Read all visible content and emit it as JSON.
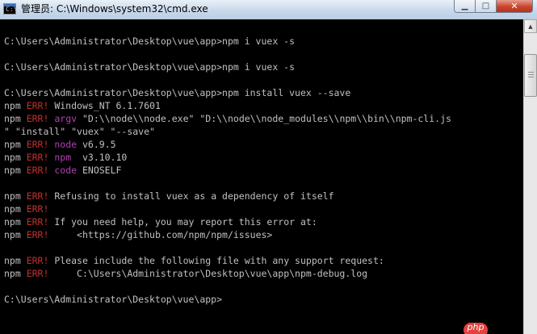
{
  "window": {
    "title": "管理员: C:\\Windows\\system32\\cmd.exe",
    "icon": "cmd-console-icon",
    "icon_glyph": "C:\\",
    "minimize_label": "▁",
    "maximize_label": "□",
    "close_label": "✕"
  },
  "console": {
    "lines": [
      {
        "parts": [
          {
            "t": "C:\\Users\\Administrator\\Desktop\\vue\\app>npm i vuex -s",
            "c": "normal"
          }
        ]
      },
      {
        "parts": [
          {
            "t": "",
            "c": "normal"
          }
        ]
      },
      {
        "parts": [
          {
            "t": "C:\\Users\\Administrator\\Desktop\\vue\\app>npm i vuex -s",
            "c": "normal"
          }
        ]
      },
      {
        "parts": [
          {
            "t": "",
            "c": "normal"
          }
        ]
      },
      {
        "parts": [
          {
            "t": "C:\\Users\\Administrator\\Desktop\\vue\\app>npm install vuex --save",
            "c": "normal"
          }
        ]
      },
      {
        "parts": [
          {
            "t": "npm ",
            "c": "normal"
          },
          {
            "t": "ERR!",
            "c": "err"
          },
          {
            "t": " Windows_NT 6.1.7601",
            "c": "normal"
          }
        ]
      },
      {
        "parts": [
          {
            "t": "npm ",
            "c": "normal"
          },
          {
            "t": "ERR!",
            "c": "err"
          },
          {
            "t": " ",
            "c": "normal"
          },
          {
            "t": "argv",
            "c": "mag"
          },
          {
            "t": " \"D:\\\\node\\\\node.exe\" \"D:\\\\node\\\\node_modules\\\\npm\\\\bin\\\\npm-cli.js",
            "c": "normal"
          }
        ]
      },
      {
        "parts": [
          {
            "t": "\" \"install\" \"vuex\" \"--save\"",
            "c": "normal"
          }
        ]
      },
      {
        "parts": [
          {
            "t": "npm ",
            "c": "normal"
          },
          {
            "t": "ERR!",
            "c": "err"
          },
          {
            "t": " ",
            "c": "normal"
          },
          {
            "t": "node",
            "c": "mag"
          },
          {
            "t": " v6.9.5",
            "c": "normal"
          }
        ]
      },
      {
        "parts": [
          {
            "t": "npm ",
            "c": "normal"
          },
          {
            "t": "ERR!",
            "c": "err"
          },
          {
            "t": " ",
            "c": "normal"
          },
          {
            "t": "npm",
            "c": "mag"
          },
          {
            "t": "  v3.10.10",
            "c": "normal"
          }
        ]
      },
      {
        "parts": [
          {
            "t": "npm ",
            "c": "normal"
          },
          {
            "t": "ERR!",
            "c": "err"
          },
          {
            "t": " ",
            "c": "normal"
          },
          {
            "t": "code",
            "c": "mag"
          },
          {
            "t": " ENOSELF",
            "c": "normal"
          }
        ]
      },
      {
        "parts": [
          {
            "t": "",
            "c": "normal"
          }
        ]
      },
      {
        "parts": [
          {
            "t": "npm ",
            "c": "normal"
          },
          {
            "t": "ERR!",
            "c": "err"
          },
          {
            "t": " Refusing to install vuex as a dependency of itself",
            "c": "normal"
          }
        ]
      },
      {
        "parts": [
          {
            "t": "npm ",
            "c": "normal"
          },
          {
            "t": "ERR!",
            "c": "err"
          }
        ]
      },
      {
        "parts": [
          {
            "t": "npm ",
            "c": "normal"
          },
          {
            "t": "ERR!",
            "c": "err"
          },
          {
            "t": " If you need help, you may report this error at:",
            "c": "normal"
          }
        ]
      },
      {
        "parts": [
          {
            "t": "npm ",
            "c": "normal"
          },
          {
            "t": "ERR!",
            "c": "err"
          },
          {
            "t": "     <https://github.com/npm/npm/issues>",
            "c": "normal"
          }
        ]
      },
      {
        "parts": [
          {
            "t": "",
            "c": "normal"
          }
        ]
      },
      {
        "parts": [
          {
            "t": "npm ",
            "c": "normal"
          },
          {
            "t": "ERR!",
            "c": "err"
          },
          {
            "t": " Please include the following file with any support request:",
            "c": "normal"
          }
        ]
      },
      {
        "parts": [
          {
            "t": "npm ",
            "c": "normal"
          },
          {
            "t": "ERR!",
            "c": "err"
          },
          {
            "t": "     C:\\Users\\Administrator\\Desktop\\vue\\app\\npm-debug.log",
            "c": "normal"
          }
        ]
      },
      {
        "parts": [
          {
            "t": "",
            "c": "normal"
          }
        ]
      },
      {
        "parts": [
          {
            "t": "C:\\Users\\Administrator\\Desktop\\vue\\app>",
            "c": "normal"
          }
        ]
      }
    ]
  },
  "scrollbar": {
    "up_arrow": "▲"
  },
  "watermark": {
    "text": "php"
  },
  "colors": {
    "console_background": "#000000",
    "console_text": "#c0c0c0",
    "err_text": "#c03030",
    "keyword_text": "#b040b0",
    "close_button": "#c7462c"
  }
}
